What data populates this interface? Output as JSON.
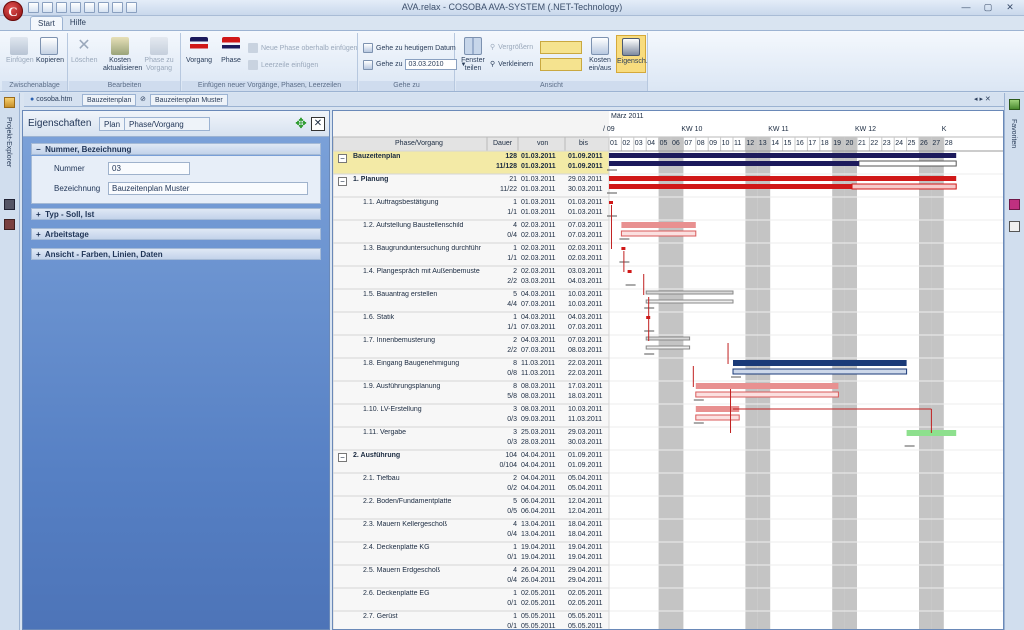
{
  "app": {
    "logo_letter": "C",
    "title": "AVA.relax - COSOBA AVA-SYSTEM (.NET-Technology)"
  },
  "window": {
    "min": "—",
    "max": "▢",
    "close": "✕"
  },
  "ribbon": {
    "tabs": [
      "Start",
      "Hilfe"
    ],
    "groups": {
      "clipboard": "Zwischenablage",
      "edit": "Bearbeiten",
      "insert": "Einfügen neuer Vorgänge, Phasen, Leerzeilen",
      "goto": "Gehe zu",
      "view": "Ansicht"
    },
    "buttons": {
      "paste": "Einfügen",
      "copy": "Kopieren",
      "delete": "Löschen",
      "update_costs": "Kosten aktualisieren",
      "phase_to_task": "Phase zu Vorgang",
      "task": "Vorgang",
      "phase": "Phase",
      "new_phase": "Neue Phase oberhalb einfügen",
      "blank_line": "Leerzeile einfügen",
      "goto_today": "Gehe zu heutigem Datum",
      "goto": "Gehe zu",
      "goto_date": "03.03.2010",
      "split_window": "Fenster teilen",
      "zoom_in": "Vergrößern",
      "zoom_out": "Verkleinern",
      "costs_onoff": "Kosten ein/aus",
      "properties": "Eigensch."
    }
  },
  "doctabs": {
    "home": "cosoba.htm",
    "plan": "Bauzeitenplan",
    "plan_full": "Bauzeitenplan Muster"
  },
  "sidebar": {
    "left": "Projekt-Explorer",
    "right": "Favoriten"
  },
  "props": {
    "title": "Eigenschaften",
    "tab_plan": "Plan",
    "tab_phase": "Phase/Vorgang",
    "sections": [
      "Nummer, Bezeichnung",
      "Typ - Soll, Ist",
      "Arbeitstage",
      "Ansicht - Farben, Linien, Daten"
    ],
    "number_label": "Nummer",
    "number_value": "03",
    "name_label": "Bezeichnung",
    "name_value": "Bauzeitenplan Muster"
  },
  "gantt": {
    "headers": {
      "phase": "Phase/Vorgang",
      "duration": "Dauer",
      "from": "von",
      "to": "bis"
    },
    "month": "März 2011",
    "month_prefix": "/ 09",
    "weeks": [
      "KW 10",
      "KW 11",
      "KW 12",
      "K"
    ],
    "days": [
      "01",
      "02",
      "03",
      "04",
      "05",
      "06",
      "07",
      "08",
      "09",
      "10",
      "11",
      "12",
      "13",
      "14",
      "15",
      "16",
      "17",
      "18",
      "19",
      "20",
      "21",
      "22",
      "23",
      "24",
      "25",
      "26",
      "27",
      "28"
    ],
    "rows": [
      {
        "name": "Bauzeitenplan",
        "dur": "128",
        "dur2": "11/128",
        "from": "01.03.2011",
        "from2": "01.03.2011",
        "to": "01.09.2011",
        "to2": "01.09.2011",
        "level": 0,
        "group": "−"
      },
      {
        "name": "1. Planung",
        "dur": "21",
        "dur2": "11/22",
        "from": "01.03.2011",
        "from2": "01.03.2011",
        "to": "29.03.2011",
        "to2": "30.03.2011",
        "level": 1,
        "group": "−"
      },
      {
        "name": "1.1. Auftragsbestätigung",
        "dur": "1",
        "dur2": "1/1",
        "from": "01.03.2011",
        "from2": "01.03.2011",
        "to": "01.03.2011",
        "to2": "01.03.2011",
        "level": 2
      },
      {
        "name": "1.2. Aufstellung Baustellenschild",
        "dur": "4",
        "dur2": "0/4",
        "from": "02.03.2011",
        "from2": "02.03.2011",
        "to": "07.03.2011",
        "to2": "07.03.2011",
        "level": 2
      },
      {
        "name": "1.3. Baugrunduntersuchung durchführ",
        "dur": "1",
        "dur2": "1/1",
        "from": "02.03.2011",
        "from2": "02.03.2011",
        "to": "02.03.2011",
        "to2": "02.03.2011",
        "level": 2
      },
      {
        "name": "1.4. Plangespräch mit Außenbemuste",
        "dur": "2",
        "dur2": "2/2",
        "from": "02.03.2011",
        "from2": "03.03.2011",
        "to": "03.03.2011",
        "to2": "04.03.2011",
        "level": 2
      },
      {
        "name": "1.5. Bauantrag erstellen",
        "dur": "5",
        "dur2": "4/4",
        "from": "04.03.2011",
        "from2": "07.03.2011",
        "to": "10.03.2011",
        "to2": "10.03.2011",
        "level": 2
      },
      {
        "name": "1.6. Statik",
        "dur": "1",
        "dur2": "1/1",
        "from": "04.03.2011",
        "from2": "07.03.2011",
        "to": "04.03.2011",
        "to2": "07.03.2011",
        "level": 2
      },
      {
        "name": "1.7. Innenbemusterung",
        "dur": "2",
        "dur2": "2/2",
        "from": "04.03.2011",
        "from2": "07.03.2011",
        "to": "07.03.2011",
        "to2": "08.03.2011",
        "level": 2
      },
      {
        "name": "1.8. Eingang Baugenehmigung",
        "dur": "8",
        "dur2": "0/8",
        "from": "11.03.2011",
        "from2": "11.03.2011",
        "to": "22.03.2011",
        "to2": "22.03.2011",
        "level": 2
      },
      {
        "name": "1.9. Ausführungsplanung",
        "dur": "8",
        "dur2": "5/8",
        "from": "08.03.2011",
        "from2": "08.03.2011",
        "to": "17.03.2011",
        "to2": "18.03.2011",
        "level": 2
      },
      {
        "name": "1.10. LV-Erstellung",
        "dur": "3",
        "dur2": "0/3",
        "from": "08.03.2011",
        "from2": "09.03.2011",
        "to": "10.03.2011",
        "to2": "11.03.2011",
        "level": 2
      },
      {
        "name": "1.11. Vergabe",
        "dur": "3",
        "dur2": "0/3",
        "from": "25.03.2011",
        "from2": "28.03.2011",
        "to": "29.03.2011",
        "to2": "30.03.2011",
        "level": 2
      },
      {
        "name": "2. Ausführung",
        "dur": "104",
        "dur2": "0/104",
        "from": "04.04.2011",
        "from2": "04.04.2011",
        "to": "01.09.2011",
        "to2": "01.09.2011",
        "level": 1,
        "group": "−"
      },
      {
        "name": "2.1. Tiefbau",
        "dur": "2",
        "dur2": "0/2",
        "from": "04.04.2011",
        "from2": "04.04.2011",
        "to": "05.04.2011",
        "to2": "05.04.2011",
        "level": 2
      },
      {
        "name": "2.2. Boden/Fundamentplatte",
        "dur": "5",
        "dur2": "0/5",
        "from": "06.04.2011",
        "from2": "06.04.2011",
        "to": "12.04.2011",
        "to2": "12.04.2011",
        "level": 2
      },
      {
        "name": "2.3. Mauern Kellergeschoß",
        "dur": "4",
        "dur2": "0/4",
        "from": "13.04.2011",
        "from2": "13.04.2011",
        "to": "18.04.2011",
        "to2": "18.04.2011",
        "level": 2
      },
      {
        "name": "2.4. Deckenplatte KG",
        "dur": "1",
        "dur2": "0/1",
        "from": "19.04.2011",
        "from2": "19.04.2011",
        "to": "19.04.2011",
        "to2": "19.04.2011",
        "level": 2
      },
      {
        "name": "2.5. Mauern Erdgeschoß",
        "dur": "4",
        "dur2": "0/4",
        "from": "26.04.2011",
        "from2": "26.04.2011",
        "to": "29.04.2011",
        "to2": "29.04.2011",
        "level": 2
      },
      {
        "name": "2.6. Deckenplatte EG",
        "dur": "1",
        "dur2": "0/1",
        "from": "02.05.2011",
        "from2": "02.05.2011",
        "to": "02.05.2011",
        "to2": "02.05.2011",
        "level": 2
      },
      {
        "name": "2.7. Gerüst",
        "dur": "1",
        "dur2": "0/1",
        "from": "05.05.2011",
        "from2": "05.05.2011",
        "to": "05.05.2011",
        "to2": "05.05.2011",
        "level": 2
      }
    ],
    "colors": {
      "summary": "#1c1a5c",
      "phase": "#d01818",
      "task": "#e89090",
      "task_done": "#d85a5a",
      "milestone": "#1a3a78",
      "active": "#8ee08e",
      "weekend": "#c4c4c4"
    }
  }
}
